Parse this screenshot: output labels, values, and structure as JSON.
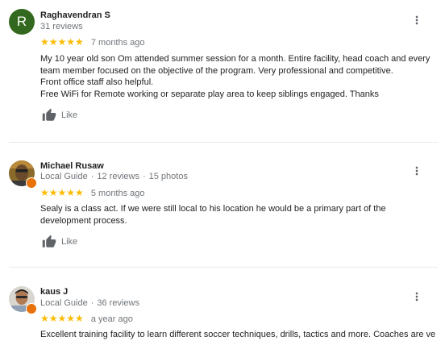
{
  "reviews": [
    {
      "name": "Raghavendran S",
      "avatar_letter": "R",
      "meta_local_guide": "",
      "meta_reviews": "31 reviews",
      "meta_photos": "",
      "stars": "★★★★★",
      "time": "7 months ago",
      "body_lines": [
        "My 10 year old son Om attended summer session for a month. Entire facility, head coach and every team member focused on the objective of the program. Very professional and competitive.",
        "Front office staff also helpful.",
        "Free WiFi for Remote working or separate play area to keep siblings engaged. Thanks"
      ],
      "like_label": "Like"
    },
    {
      "name": "Michael Rusaw",
      "meta_local_guide": "Local Guide",
      "meta_reviews": "12 reviews",
      "meta_photos": "15 photos",
      "stars": "★★★★★",
      "time": "5 months ago",
      "body_lines": [
        "Sealy is a class act. If we were still local to his location he would be a primary part of the development process."
      ],
      "like_label": "Like"
    },
    {
      "name": "kaus J",
      "meta_local_guide": "Local Guide",
      "meta_reviews": "36 reviews",
      "meta_photos": "",
      "stars": "★★★★★",
      "time": "a year ago",
      "body_lines": [
        "Excellent training facility to learn different soccer techniques, drills, tactics and more. Coaches are very"
      ],
      "like_label": ""
    }
  ],
  "colors": {
    "star": "#fbbc04",
    "avatar_r_bg": "#33691e",
    "local_guide_badge": "#e8710a",
    "secondary_text": "#70757a"
  },
  "icons": {
    "menu": "more-vert-icon",
    "like": "thumb-up-icon",
    "badge": "local-guide-badge-icon"
  }
}
